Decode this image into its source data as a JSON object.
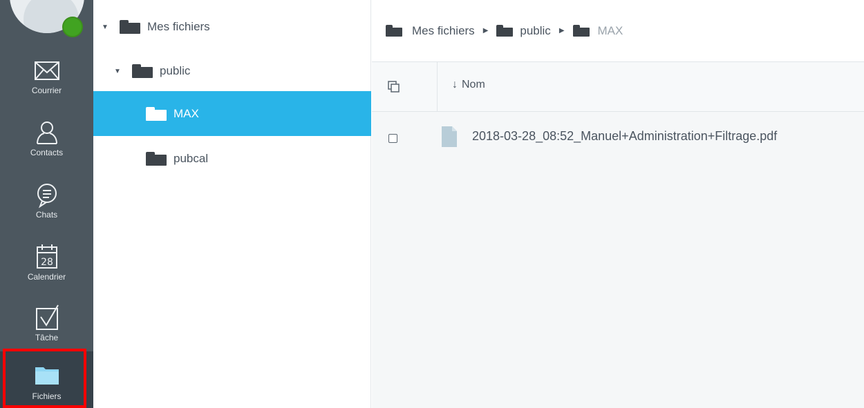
{
  "rail": {
    "items": [
      {
        "label": "Courrier",
        "icon": "mail-icon"
      },
      {
        "label": "Contacts",
        "icon": "person-icon"
      },
      {
        "label": "Chats",
        "icon": "chat-icon"
      },
      {
        "label": "Calendrier",
        "icon": "calendar-icon",
        "day": "28"
      },
      {
        "label": "Tâche",
        "icon": "task-check-icon"
      },
      {
        "label": "Fichiers",
        "icon": "folder-icon",
        "active": true
      }
    ],
    "presence_color": "#41a321"
  },
  "tree": {
    "items": [
      {
        "label": "Mes fichiers",
        "expanded": true
      },
      {
        "label": "public",
        "expanded": true
      },
      {
        "label": "MAX",
        "selected": true
      },
      {
        "label": "pubcal"
      }
    ],
    "selected_color": "#29b4e8"
  },
  "breadcrumb": [
    "Mes fichiers",
    "public",
    "MAX"
  ],
  "table": {
    "sort_label": "Nom",
    "files": [
      {
        "name": "2018-03-28_08:52_Manuel+Administration+Filtrage.pdf"
      }
    ]
  }
}
